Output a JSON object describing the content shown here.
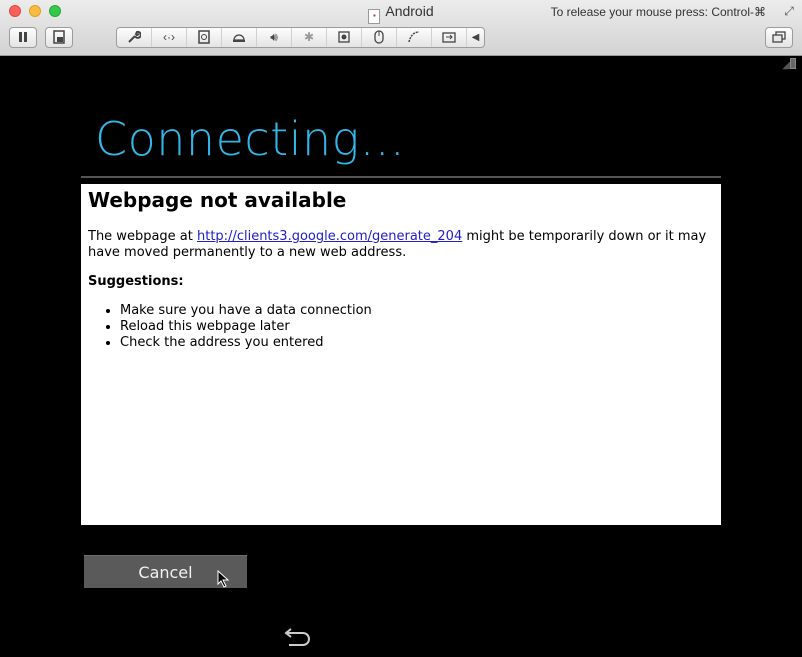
{
  "window": {
    "title": "Android",
    "release_message": "To release your mouse press: Control-⌘"
  },
  "toolbar": {
    "icons": [
      "pause-icon",
      "snapshot-icon",
      "settings-icon",
      "network-icon",
      "hard-disk-icon",
      "optical-drive-icon",
      "sound-icon",
      "bluetooth-icon",
      "camera-icon",
      "usb-mouse-icon",
      "serial-port-icon",
      "shared-folder-icon",
      "collapse-arrow-icon",
      "unity-icon"
    ],
    "collapse_glyph": "◀"
  },
  "dialog": {
    "title": "Connecting...",
    "cancel_label": "Cancel"
  },
  "webview": {
    "heading": "Webpage not available",
    "body_prefix": "The webpage at ",
    "link_text": "http://clients3.google.com/generate_204",
    "body_suffix": " might be temporarily down or it may have moved permanently to a new web address.",
    "suggestions_heading": "Suggestions:",
    "suggestions": [
      "Make sure you have a data connection",
      "Reload this webpage later",
      "Check the address you entered"
    ]
  },
  "colors": {
    "holo_blue": "#33b5e5",
    "link": "#2020c8",
    "background": "#000000",
    "button": "#5a5a5a"
  }
}
